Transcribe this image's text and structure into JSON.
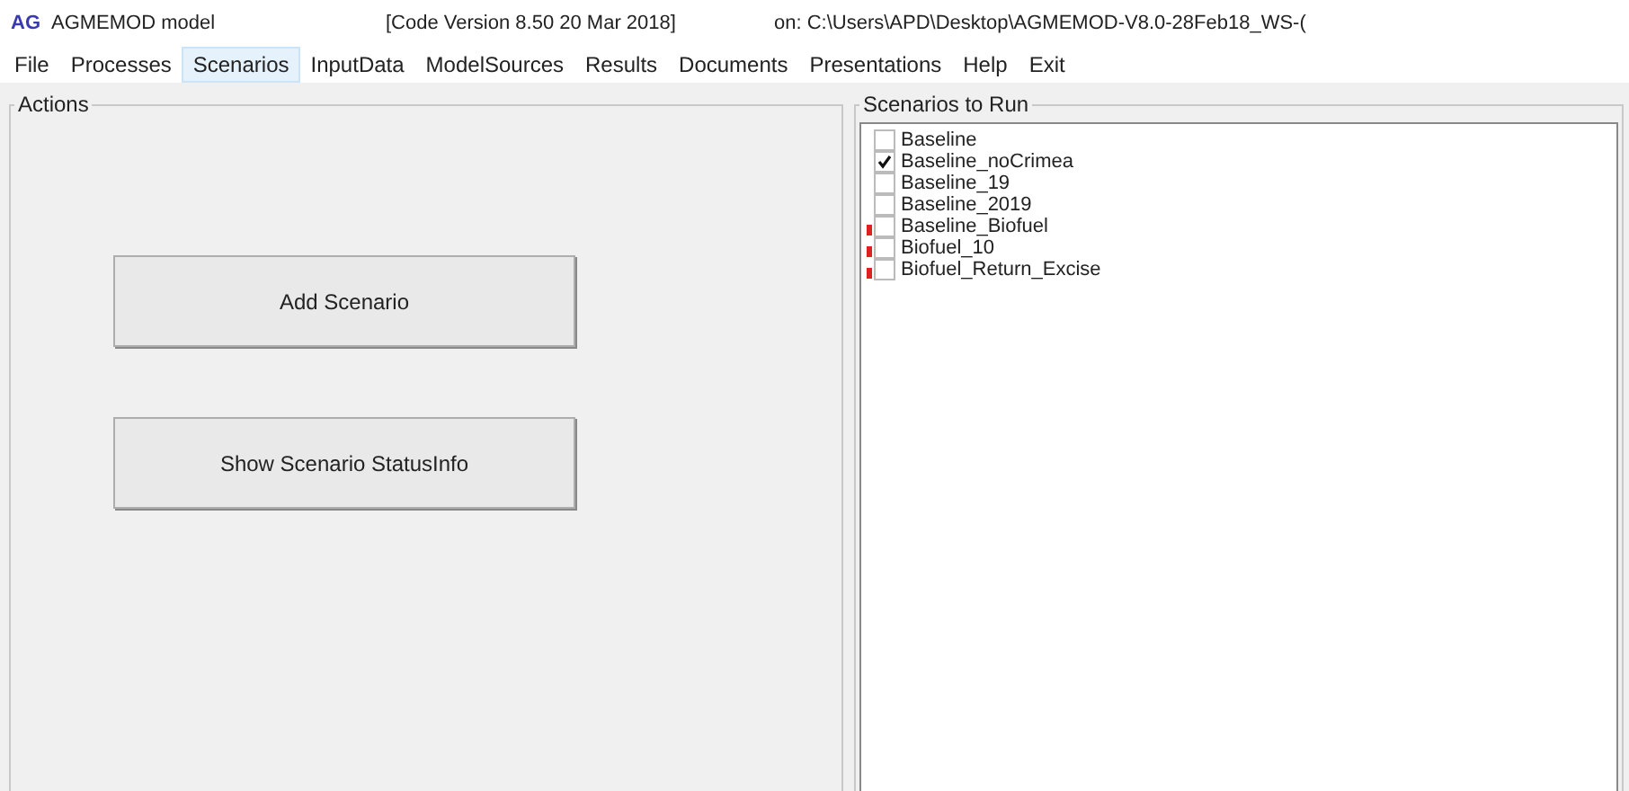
{
  "window": {
    "logo": "AG",
    "title": "AGMEMOD model",
    "version": "[Code Version 8.50  20 Mar 2018]",
    "path": "on:  C:\\Users\\APD\\Desktop\\AGMEMOD-V8.0-28Feb18_WS-("
  },
  "menu": [
    {
      "label": "File",
      "selected": false
    },
    {
      "label": "Processes",
      "selected": false
    },
    {
      "label": "Scenarios",
      "selected": true
    },
    {
      "label": "InputData",
      "selected": false
    },
    {
      "label": "ModelSources",
      "selected": false
    },
    {
      "label": "Results",
      "selected": false
    },
    {
      "label": "Documents",
      "selected": false
    },
    {
      "label": "Presentations",
      "selected": false
    },
    {
      "label": "Help",
      "selected": false
    },
    {
      "label": "Exit",
      "selected": false
    }
  ],
  "actions": {
    "title": "Actions",
    "buttons": [
      "Add Scenario",
      "Show Scenario StatusInfo"
    ]
  },
  "scenarios": {
    "title": "Scenarios to Run",
    "items": [
      {
        "label": "Baseline",
        "checked": false,
        "warning": false
      },
      {
        "label": "Baseline_noCrimea",
        "checked": true,
        "warning": false
      },
      {
        "label": "Baseline_19",
        "checked": false,
        "warning": false
      },
      {
        "label": "Baseline_2019",
        "checked": false,
        "warning": false
      },
      {
        "label": "Baseline_Biofuel",
        "checked": false,
        "warning": true
      },
      {
        "label": "Biofuel_10",
        "checked": false,
        "warning": true
      },
      {
        "label": "Biofuel_Return_Excise",
        "checked": false,
        "warning": true
      }
    ]
  }
}
